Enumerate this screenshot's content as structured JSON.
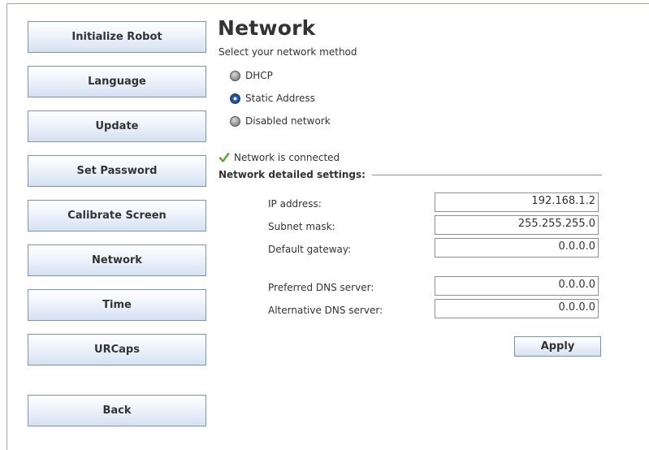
{
  "sidebar": {
    "items": [
      {
        "label": "Initialize Robot"
      },
      {
        "label": "Language"
      },
      {
        "label": "Update"
      },
      {
        "label": "Set Password"
      },
      {
        "label": "Calibrate Screen"
      },
      {
        "label": "Network"
      },
      {
        "label": "Time"
      },
      {
        "label": "URCaps"
      }
    ],
    "back_label": "Back"
  },
  "main": {
    "title": "Network",
    "subtitle": "Select your network method",
    "methods": [
      {
        "label": "DHCP",
        "selected": false
      },
      {
        "label": "Static Address",
        "selected": true
      },
      {
        "label": "Disabled network",
        "selected": false
      }
    ],
    "status": {
      "text": "Network is connected",
      "icon": "checkmark-icon",
      "color": "#3a8a1c"
    },
    "settings_heading": "Network detailed settings:",
    "fields": {
      "ip": {
        "label": "IP address:",
        "value": "192.168.1.2"
      },
      "subnet": {
        "label": "Subnet mask:",
        "value": "255.255.255.0"
      },
      "gateway": {
        "label": "Default gateway:",
        "value": "0.0.0.0"
      },
      "dns1": {
        "label": "Preferred DNS server:",
        "value": "0.0.0.0"
      },
      "dns2": {
        "label": "Alternative DNS server:",
        "value": "0.0.0.0"
      }
    },
    "apply_label": "Apply"
  },
  "colors": {
    "accent": "#7e93b2",
    "radio_selected": "#2a62b8"
  }
}
